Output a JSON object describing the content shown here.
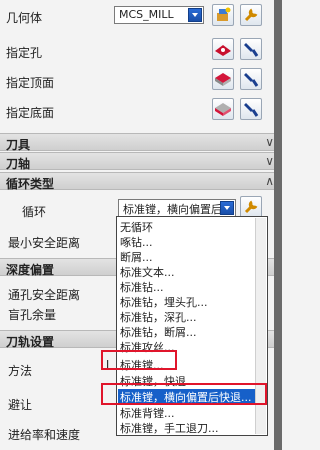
{
  "geometry": {
    "label": "几何体",
    "value": "MCS_MILL"
  },
  "specify_holes": "指定孔",
  "specify_top": "指定顶面",
  "specify_bottom": "指定底面",
  "sections": {
    "tool": "刀具",
    "axis": "刀轴",
    "cycle_type": "循环类型",
    "depth_offset": "深度偏置",
    "toolpath_settings": "刀轨设置"
  },
  "cycle": {
    "label": "循环",
    "value": "标准镗，横向偏置后"
  },
  "min_clearance": "最小安全距离",
  "through_clearance": "通孔安全距离",
  "blind_stock": "盲孔余量",
  "method": "方法",
  "avoid": "避让",
  "feeds_speeds": "进给率和速度",
  "method_value_partial": "I",
  "dropdown": {
    "items": [
      "无循环",
      "啄钻...",
      "断屑...",
      "标准文本...",
      "标准钻...",
      "标准钻，埋头孔...",
      "标准钻，深孔...",
      "标准钻，断屑...",
      "标准攻丝...",
      "标准镗...",
      "标准镗，快退",
      "标准镗，横向偏置后快退...",
      "标准背镗...",
      "标准镗，手工退刀..."
    ],
    "selected_index": 11
  },
  "colors": {
    "selection": "#1660c9",
    "highlight_box": "#e0152b"
  }
}
